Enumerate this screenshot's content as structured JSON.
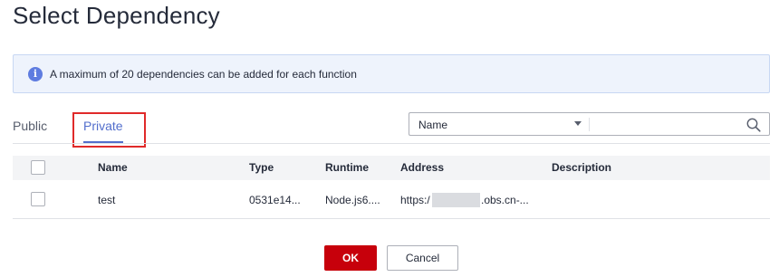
{
  "dialog": {
    "title": "Select Dependency"
  },
  "notice": {
    "icon": "info-icon",
    "icon_glyph": "i",
    "text": "A maximum of 20 dependencies can be added for each function"
  },
  "tabs": [
    {
      "label": "Public",
      "active": false
    },
    {
      "label": "Private",
      "active": true
    }
  ],
  "filter": {
    "selected": "Name",
    "search_value": "",
    "search_placeholder": ""
  },
  "table": {
    "columns": [
      "Name",
      "Type",
      "Runtime",
      "Address",
      "Description"
    ],
    "rows": [
      {
        "name": "test",
        "type": "0531e14...",
        "runtime": "Node.js6....",
        "address_prefix": "https:/",
        "address_suffix": ".obs.cn-...",
        "description": ""
      }
    ]
  },
  "buttons": {
    "ok": "OK",
    "cancel": "Cancel"
  },
  "colors": {
    "accent": "#526ecc",
    "primary_button": "#c7000b",
    "highlight_border": "#e02a2a",
    "info_background": "#eef3fc"
  }
}
